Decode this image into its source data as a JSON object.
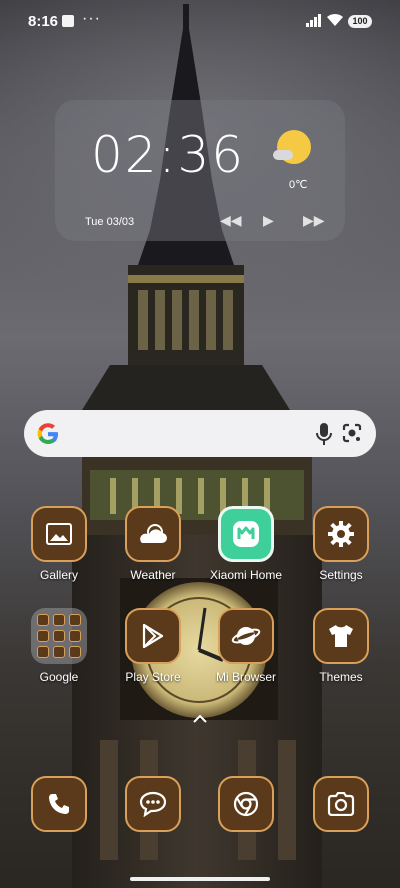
{
  "status_bar": {
    "time": "8:16",
    "more": "···",
    "battery": "100"
  },
  "clock_widget": {
    "time": "02:36",
    "date": "Tue 03/03",
    "temperature": "0℃",
    "media_prev": "◀◀",
    "media_play": "▶",
    "media_next": "▶▶"
  },
  "search_bar": {
    "logo_letter": "G"
  },
  "apps": {
    "gallery": "Gallery",
    "weather": "Weather",
    "xiaomi_home": "Xiaomi Home",
    "settings": "Settings",
    "google": "Google",
    "play_store": "Play Store",
    "mi_browser": "Mi Browser",
    "themes": "Themes"
  },
  "icons": {
    "accent_fill": "#5a3a1a",
    "accent_border": "#d9a05a",
    "mihome_green": "#3ecf9b"
  }
}
